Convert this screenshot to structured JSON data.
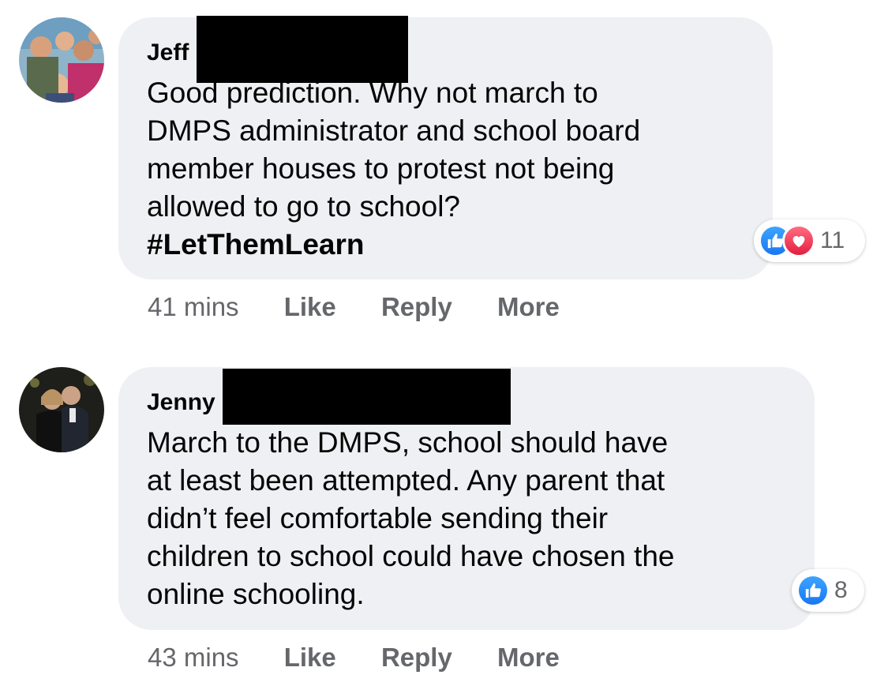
{
  "comments": [
    {
      "author": "Jeff",
      "text": "Good prediction. Why not march to\nDMPS administrator and school board\nmember houses to protest not being\nallowed to go to school?",
      "hashtag": "#LetThemLearn",
      "reaction_count": "11",
      "reactions": [
        "like-icon",
        "love-icon"
      ],
      "time": "41 mins",
      "like_label": "Like",
      "reply_label": "Reply",
      "more_label": "More"
    },
    {
      "author": "Jenny",
      "text": "March to the DMPS, school should have\nat least been attempted. Any parent that\ndidn’t feel comfortable sending their\nchildren to school could have chosen the\nonline schooling.",
      "reaction_count": "8",
      "reactions": [
        "like-icon"
      ],
      "time": "43 mins",
      "like_label": "Like",
      "reply_label": "Reply",
      "more_label": "More"
    }
  ],
  "colors": {
    "bubble": "#eff0f3",
    "meta_text": "#65676b",
    "like_blue": "#1877f2",
    "love_red": "#e41e3f"
  }
}
